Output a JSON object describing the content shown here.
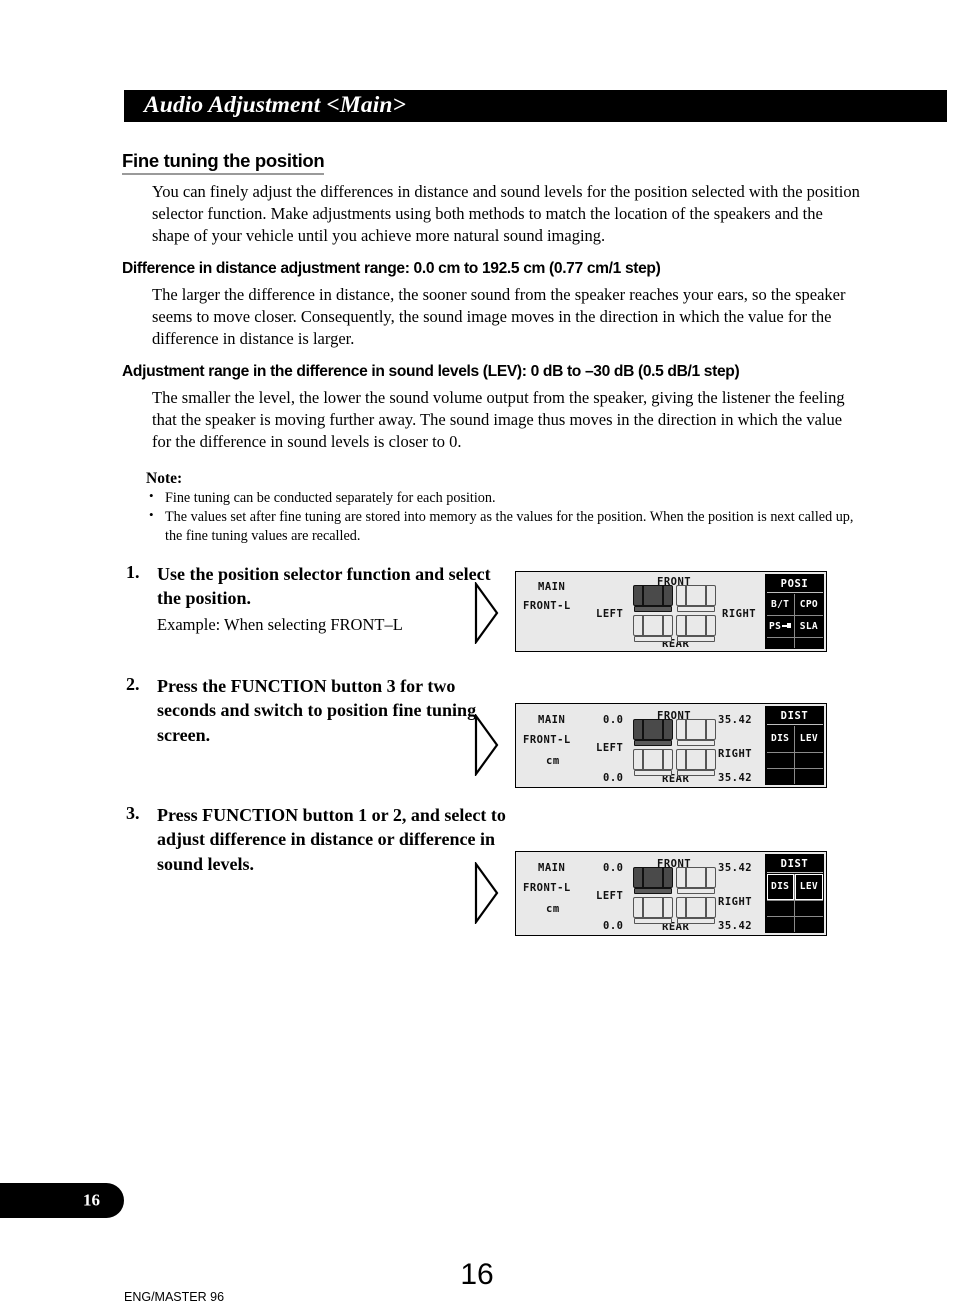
{
  "header": {
    "title": "Audio Adjustment <Main>"
  },
  "section": {
    "heading": "Fine tuning the position",
    "intro": "You can finely adjust the differences in distance and sound levels for the position selected with the position selector function. Make adjustments using both methods to match the location of the speakers and the shape of your vehicle until you achieve more natural sound imaging.",
    "subheads": [
      {
        "title": "Difference in distance adjustment range: 0.0 cm to 192.5 cm (0.77 cm/1 step)",
        "body": "The larger the difference in distance, the sooner sound from the speaker reaches your ears, so the speaker seems to move closer. Consequently, the sound image moves in the direction in which the value for the difference in distance is larger."
      },
      {
        "title": "Adjustment range in the difference in sound levels (LEV): 0 dB to –30 dB (0.5 dB/1 step)",
        "body": "The smaller the level, the lower the sound volume output from the speaker, giving the listener the feeling that the speaker is moving further away. The sound image thus moves in the direction in which the value for the difference in sound levels is closer to 0."
      }
    ]
  },
  "note": {
    "title": "Note:",
    "bullet_glyph": "•",
    "items": [
      "Fine tuning can be conducted separately for each position.",
      "The values set after fine tuning are stored into memory as the values for the position. When the position is next called up, the fine tuning values are recalled."
    ]
  },
  "steps": [
    {
      "number": "1.",
      "title": "Use the position selector function and select the position.",
      "example": "Example: When selecting FRONT–L"
    },
    {
      "number": "2.",
      "title": "Press the FUNCTION button 3 for two seconds and switch to position fine tuning screen.",
      "example": ""
    },
    {
      "number": "3.",
      "title": "Press FUNCTION button 1 or 2, and select to adjust difference in distance or difference in sound levels.",
      "example": ""
    }
  ],
  "displays": [
    {
      "source": "MAIN",
      "position": "FRONT-L",
      "unit": "",
      "left_label": "LEFT",
      "right_label": "RIGHT",
      "front_label": "FRONT",
      "rear_label": "REAR",
      "values": {
        "front_left": "",
        "front_right": "",
        "rear_left": "",
        "rear_right": ""
      },
      "keys": {
        "title": "POSI",
        "row1": [
          {
            "label": "B/T",
            "selected": false
          },
          {
            "label": "CPO",
            "selected": false
          }
        ],
        "row2": [
          {
            "label": "PS",
            "icon": "left-right-arrow-icon",
            "selected": false
          },
          {
            "label": "SLA",
            "selected": false
          }
        ],
        "row3": [
          {
            "label": "",
            "selected": false
          },
          {
            "label": "",
            "selected": false
          }
        ]
      }
    },
    {
      "source": "MAIN",
      "position": "FRONT-L",
      "unit": "cm",
      "left_label": "LEFT",
      "right_label": "RIGHT",
      "front_label": "FRONT",
      "rear_label": "REAR",
      "values": {
        "front_left": "0.0",
        "front_right": "35.42",
        "rear_left": "0.0",
        "rear_right": "35.42"
      },
      "keys": {
        "title": "DIST",
        "row1": [
          {
            "label": "DIS",
            "selected": false
          },
          {
            "label": "LEV",
            "selected": false
          }
        ],
        "row2": [
          {
            "label": "",
            "selected": false
          },
          {
            "label": "",
            "selected": false
          }
        ],
        "row3": [
          {
            "label": "",
            "selected": false
          },
          {
            "label": "",
            "selected": false
          }
        ]
      }
    },
    {
      "source": "MAIN",
      "position": "FRONT-L",
      "unit": "cm",
      "left_label": "LEFT",
      "right_label": "RIGHT",
      "front_label": "FRONT",
      "rear_label": "REAR",
      "values": {
        "front_left": "0.0",
        "front_right": "35.42",
        "rear_left": "0.0",
        "rear_right": "35.42"
      },
      "keys": {
        "title": "DIST",
        "row1": [
          {
            "label": "DIS",
            "selected": true
          },
          {
            "label": "LEV",
            "selected": true
          }
        ],
        "row2": [
          {
            "label": "",
            "selected": false
          },
          {
            "label": "",
            "selected": false
          }
        ],
        "row3": [
          {
            "label": "",
            "selected": false
          },
          {
            "label": "",
            "selected": false
          }
        ]
      }
    }
  ],
  "footer": {
    "page_tab": "16",
    "folio": "16",
    "imprint": "ENG/MASTER 96"
  },
  "colors": {
    "header_bar": "#000000",
    "lcd_background": "#e9e9e9",
    "lcd_key_background": "#000000",
    "rule": "#9a9a9a"
  }
}
